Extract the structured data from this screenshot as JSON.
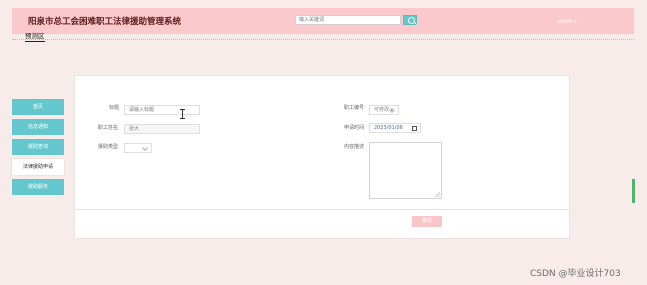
{
  "header": {
    "app_title": "阳泉市总工会困难职工法律援助管理系统",
    "search_placeholder": "输入关键词",
    "user_menu": "admin ▾"
  },
  "breadcrumb": "预测区",
  "sidebar": {
    "items": [
      {
        "label": "首页",
        "active": false
      },
      {
        "label": "信息通知",
        "active": false
      },
      {
        "label": "援助查询",
        "active": false
      },
      {
        "label": "法律援助申请",
        "active": true
      },
      {
        "label": "援助服务",
        "active": false
      }
    ]
  },
  "form": {
    "title_label": "标题",
    "title_placeholder": "请输入标题",
    "worker_no_label": "职工编号",
    "worker_no_value": "可修改 ▾",
    "worker_name_label": "职工姓名",
    "worker_name_value": "张大",
    "apply_time_label": "申请时间",
    "apply_time_value": "2023/01/06",
    "aid_type_label": "援助类型",
    "aid_type_value": "",
    "content_label": "内容描述",
    "submit_label": "提交"
  },
  "watermark": "CSDN @毕业设计703",
  "colors": {
    "header_bg": "#fbc8cb",
    "accent": "#63c7cd",
    "page_bg": "#f7ecea",
    "submit": "#f9c6c8"
  },
  "icons": [
    "search-icon",
    "calendar-icon",
    "chevron-down-icon",
    "resize-handle-icon",
    "text-cursor-icon"
  ]
}
